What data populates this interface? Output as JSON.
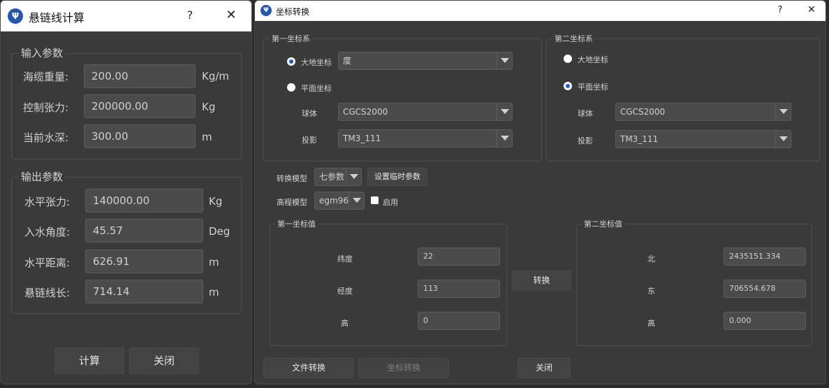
{
  "left": {
    "title": "悬链线计算",
    "help": "?",
    "close": "✕",
    "input_group": "输入参数",
    "inputs": [
      {
        "label": "海缆重量:",
        "value": "200.00",
        "unit": "Kg/m"
      },
      {
        "label": "控制张力:",
        "value": "200000.00",
        "unit": "Kg"
      },
      {
        "label": "当前水深:",
        "value": "300.00",
        "unit": "m"
      }
    ],
    "output_group": "输出参数",
    "outputs": [
      {
        "label": "水平张力:",
        "value": "140000.00",
        "unit": "Kg"
      },
      {
        "label": "入水角度:",
        "value": "45.57",
        "unit": "Deg"
      },
      {
        "label": "水平距离:",
        "value": "626.91",
        "unit": "m"
      },
      {
        "label": "悬链线长:",
        "value": "714.14",
        "unit": "m"
      }
    ],
    "btn_calc": "计算",
    "btn_close": "关闭"
  },
  "right": {
    "title": "坐标转换",
    "help": "?",
    "close": "✕",
    "first_sys": {
      "title": "第一坐标系",
      "geo_label": "大地坐标",
      "geo_unit": "度",
      "plane_label": "平面坐标",
      "ellipsoid_label": "球体",
      "ellipsoid": "CGCS2000",
      "proj_label": "投影",
      "proj": "TM3_111",
      "selected": "geo"
    },
    "second_sys": {
      "title": "第二坐标系",
      "geo_label": "大地坐标",
      "plane_label": "平面坐标",
      "ellipsoid_label": "球体",
      "ellipsoid": "CGCS2000",
      "proj_label": "投影",
      "proj": "TM3_111",
      "selected": "plane"
    },
    "model_label": "转换模型",
    "model": "七参数",
    "temp_params": "设置临时参数",
    "height_label": "高程模型",
    "height_model": "egm96",
    "enable_label": "启用",
    "first_vals": {
      "title": "第一坐标值",
      "rows": [
        {
          "label": "纬度",
          "value": "22"
        },
        {
          "label": "经度",
          "value": "113"
        },
        {
          "label": "高",
          "value": "0"
        }
      ]
    },
    "convert": "转换",
    "second_vals": {
      "title": "第二坐标值",
      "rows": [
        {
          "label": "北",
          "value": "2435151.334"
        },
        {
          "label": "东",
          "value": "706554.678"
        },
        {
          "label": "高",
          "value": "0.000"
        }
      ]
    },
    "btn_file": "文件转换",
    "btn_coord": "坐标转换",
    "btn_close": "关闭"
  }
}
